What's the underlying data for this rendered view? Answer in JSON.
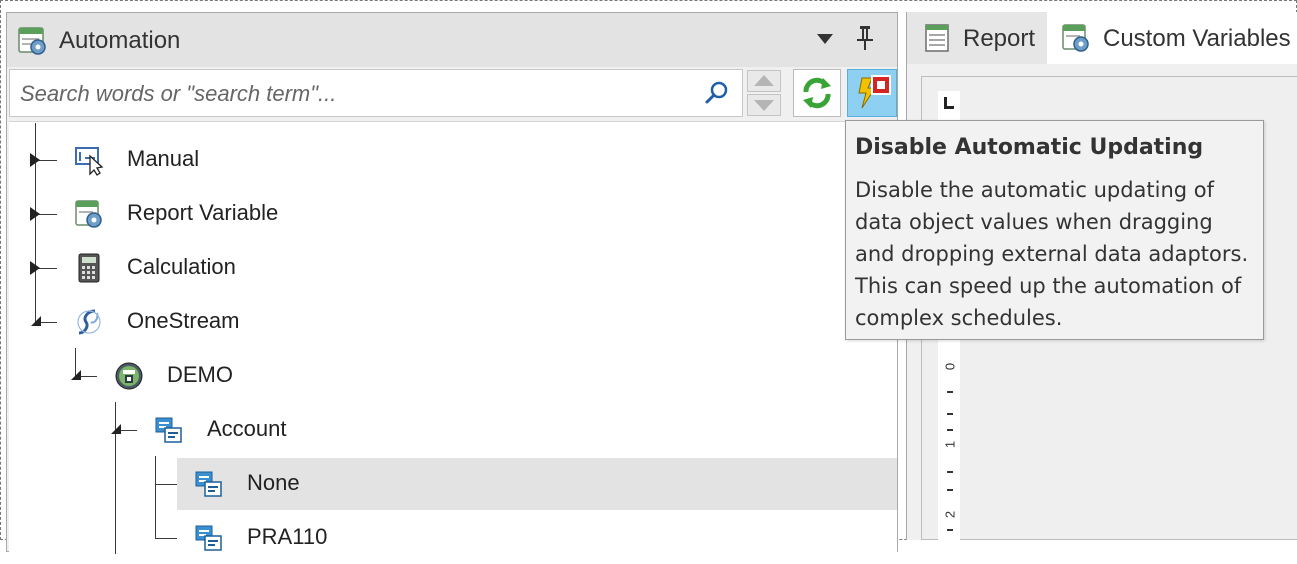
{
  "automation_panel": {
    "title": "Automation",
    "search": {
      "placeholder": "Search words or \"search term\"...",
      "value": ""
    }
  },
  "tree": {
    "nodes": [
      {
        "label": "Manual",
        "icon": "manual-icon",
        "expanded": false
      },
      {
        "label": "Report Variable",
        "icon": "report-variable-icon",
        "expanded": false
      },
      {
        "label": "Calculation",
        "icon": "calculator-icon",
        "expanded": false
      },
      {
        "label": "OneStream",
        "icon": "onestream-icon",
        "expanded": true
      },
      {
        "label": "DEMO",
        "icon": "database-icon",
        "expanded": true
      },
      {
        "label": "Account",
        "icon": "dimension-icon",
        "expanded": true
      },
      {
        "label": "None",
        "icon": "dimension-icon",
        "selected": true
      },
      {
        "label": "PRA110",
        "icon": "dimension-icon",
        "selected": false
      }
    ]
  },
  "right_panel": {
    "tabs": [
      {
        "label": "Report",
        "icon": "report-icon",
        "active": false
      },
      {
        "label": "Custom Variables",
        "icon": "custom-variables-icon",
        "active": true
      }
    ],
    "ruler_numbers": [
      "0",
      "1",
      "2"
    ]
  },
  "tooltip": {
    "title": "Disable Automatic Updating",
    "lines": [
      "Disable the automatic updating of",
      "data object values when dragging",
      "and dropping external data adaptors.",
      "This can speed up the automation of",
      "complex schedules."
    ]
  },
  "colors": {
    "selected_button_bg": "#8ed0f2",
    "selected_row_bg": "#e3e3e3",
    "panel_bg": "#f0f0f0"
  }
}
